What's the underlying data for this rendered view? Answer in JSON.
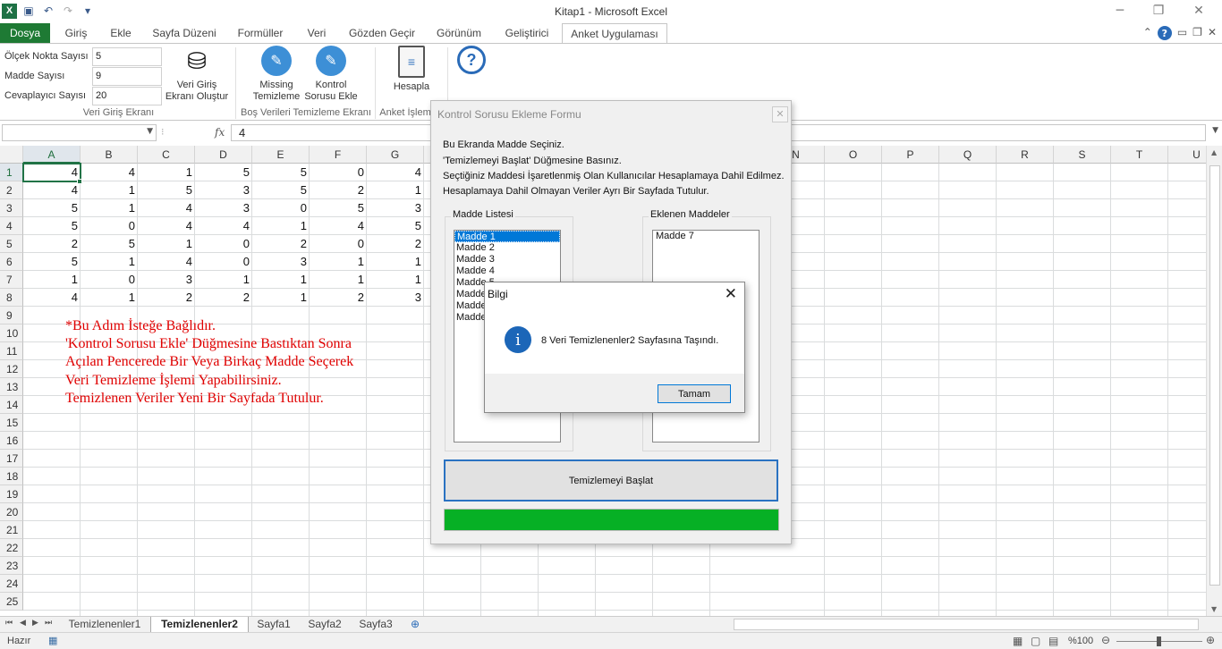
{
  "window": {
    "title": "Kitap1  -  Microsoft Excel",
    "minimize": "─",
    "restore": "❐",
    "close": "✕"
  },
  "tabs": [
    "Dosya",
    "Giriş",
    "Ekle",
    "Sayfa Düzeni",
    "Formüller",
    "Veri",
    "Gözden Geçir",
    "Görünüm",
    "Geliştirici",
    "Anket Uygulaması"
  ],
  "ribbon": {
    "fields": [
      {
        "label": "Ölçek Nokta Sayısı",
        "value": "5"
      },
      {
        "label": "Madde Sayısı",
        "value": "9"
      },
      {
        "label": "Cevaplayıcı Sayısı",
        "value": "20"
      }
    ],
    "buttons": {
      "veri_giris": [
        "Veri Giriş",
        "Ekranı Oluştur"
      ],
      "missing": [
        "Missing",
        "Temizleme"
      ],
      "kontrol": [
        "Kontrol",
        "Sorusu Ekle"
      ],
      "hesapla": "Hesapla"
    },
    "groups": {
      "veri_giris": "Veri Giriş Ekranı",
      "bos_veri": "Boş Verileri Temizleme Ekranı",
      "anket": "Anket İşlem"
    }
  },
  "formula_bar": {
    "name_box": "",
    "fx": "fx",
    "value": "4"
  },
  "grid": {
    "columns": [
      "A",
      "B",
      "C",
      "D",
      "E",
      "F",
      "G",
      "H",
      "I",
      "J",
      "K",
      "L",
      "N",
      "O",
      "P",
      "Q",
      "R",
      "S",
      "T",
      "U"
    ],
    "rows": [
      "1",
      "2",
      "3",
      "4",
      "5",
      "6",
      "7",
      "8",
      "9",
      "10",
      "11",
      "12",
      "13",
      "14",
      "15",
      "16",
      "17",
      "18",
      "19",
      "20",
      "21",
      "22",
      "23",
      "24",
      "25"
    ],
    "data": [
      [
        "4",
        "4",
        "1",
        "5",
        "5",
        "0",
        "4"
      ],
      [
        "4",
        "1",
        "5",
        "3",
        "5",
        "2",
        "1"
      ],
      [
        "5",
        "1",
        "4",
        "3",
        "0",
        "5",
        "3"
      ],
      [
        "5",
        "0",
        "4",
        "4",
        "1",
        "4",
        "5"
      ],
      [
        "2",
        "5",
        "1",
        "0",
        "2",
        "0",
        "2"
      ],
      [
        "5",
        "1",
        "4",
        "0",
        "3",
        "1",
        "1"
      ],
      [
        "1",
        "0",
        "3",
        "1",
        "1",
        "1",
        "1"
      ],
      [
        "4",
        "1",
        "2",
        "2",
        "1",
        "2",
        "3"
      ]
    ],
    "note": [
      "*Bu Adım İsteğe Bağlıdır.",
      "'Kontrol Sorusu Ekle' Düğmesine Bastıktan Sonra",
      "Açılan Pencerede Bir Veya Birkaç Madde Seçerek",
      "Veri Temizleme İşlemi Yapabilirsiniz.",
      "Temizlenen Veriler Yeni Bir Sayfada Tutulur."
    ]
  },
  "sheets": {
    "tabs": [
      "Temizlenenler1",
      "Temizlenenler2",
      "Sayfa1",
      "Sayfa2",
      "Sayfa3"
    ],
    "active": "Temizlenenler2"
  },
  "status": {
    "text": "Hazır",
    "zoom": "%100"
  },
  "form": {
    "title": "Kontrol Sorusu Ekleme Formu",
    "lines": [
      "Bu Ekranda Madde Seçiniz.",
      "'Temizlemeyi Başlat' Düğmesine Basınız.",
      "Seçtiğiniz Maddesi İşaretlenmiş Olan Kullanıcılar Hesaplamaya Dahil Edilmez.",
      "Hesaplamaya Dahil Olmayan Veriler Ayrı Bir Sayfada Tutulur."
    ],
    "list_label": "Madde Listesi",
    "list_items": [
      "Madde 1",
      "Madde 2",
      "Madde 3",
      "Madde 4",
      "Madde 5",
      "Madde 6",
      "Madde 8",
      "Madde 9"
    ],
    "added_label": "Eklenen Maddeler",
    "added_items": [
      "Madde 7"
    ],
    "start_button": "Temizlemeyi Başlat",
    "progress": 1.0
  },
  "msgbox": {
    "title": "Bilgi",
    "icon": "info-icon",
    "text": "8 Veri Temizlenenler2 Sayfasına Taşındı.",
    "ok": "Tamam"
  },
  "colors": {
    "excel_green": "#217346",
    "file_tab": "#1e7a34",
    "note_red": "#e00000",
    "progress_green": "#06b025"
  }
}
